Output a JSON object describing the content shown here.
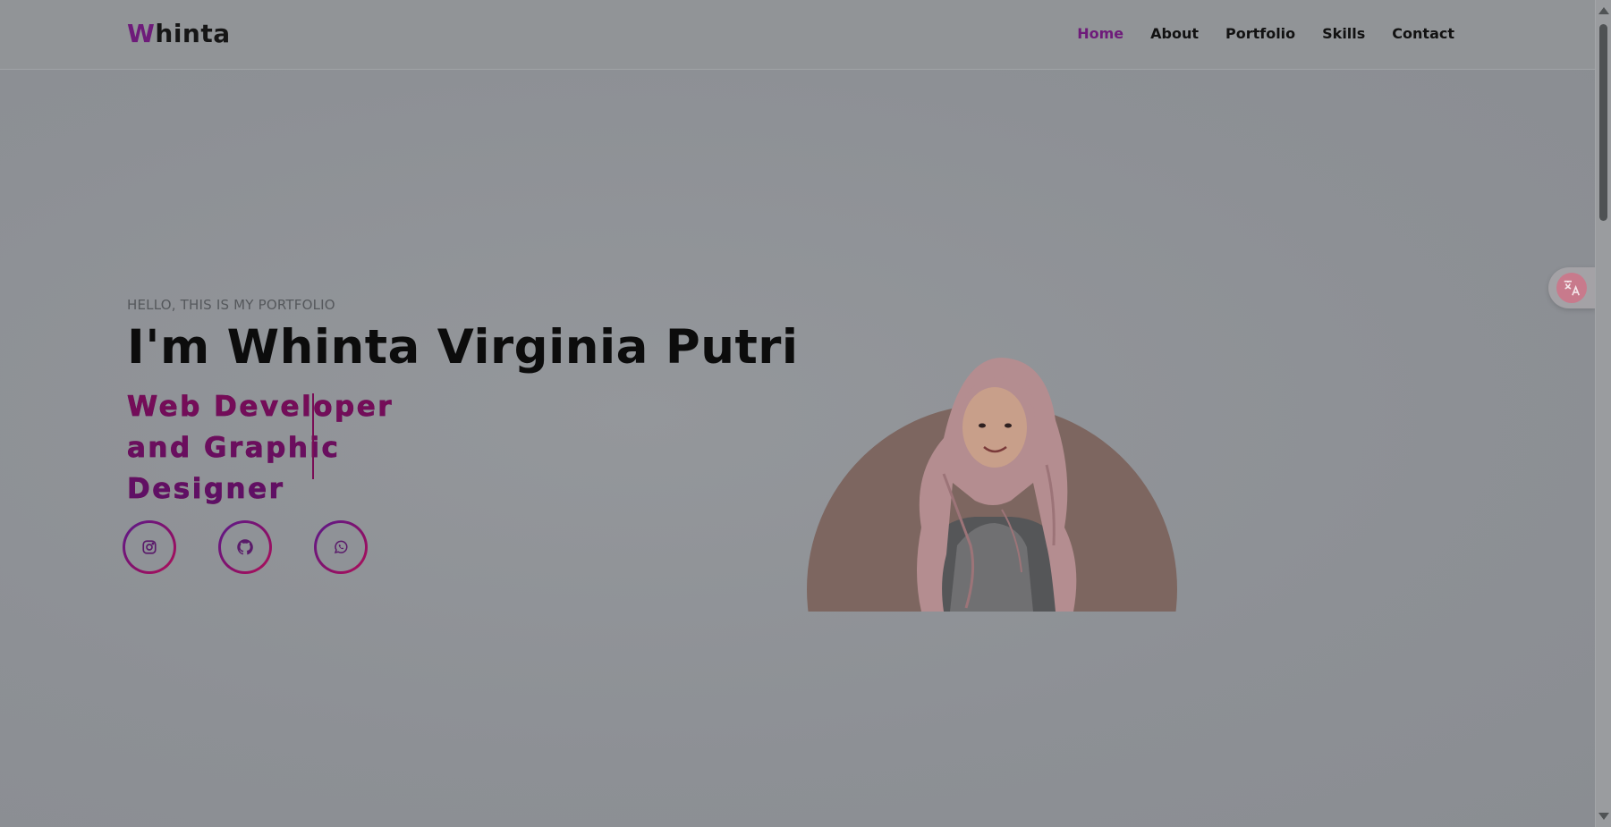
{
  "header": {
    "logo_first": "W",
    "logo_rest": "hinta",
    "nav": [
      "Home",
      "About",
      "Portfolio",
      "Skills",
      "Contact"
    ],
    "active_nav": "Home"
  },
  "hero": {
    "subtitle": "HELLO, THIS IS MY PORTFOLIO",
    "title": "I'm Whinta Virginia Putri",
    "role_line1": "Web Developer",
    "role_line2": "and Graphic",
    "role_line3": "Designer"
  },
  "socials": [
    {
      "icon": "instagram-icon"
    },
    {
      "icon": "github-icon"
    },
    {
      "icon": "whatsapp-icon"
    }
  ],
  "colors": {
    "accent": "#6e1b7a",
    "role_gradient_start": "#7a0c55",
    "role_gradient_end": "#5a1068",
    "portrait_bg": "#7d6660"
  }
}
